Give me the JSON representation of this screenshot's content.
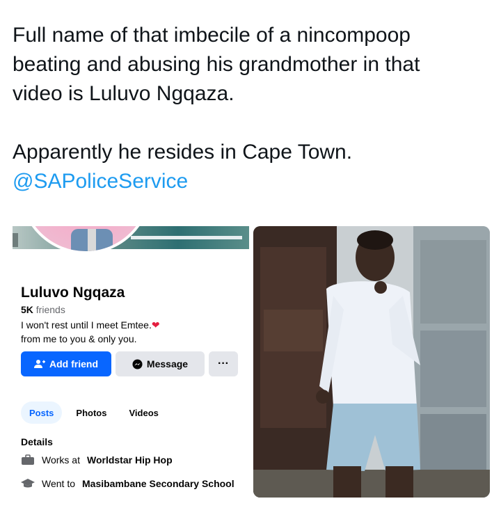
{
  "tweet": {
    "line1": "Full name of that imbecile of a nincompoop",
    "line2": "beating and abusing his grandmother in that",
    "line3": "video is Luluvo Ngqaza.",
    "line4": "Apparently he resides in Cape Town.",
    "mention": "@SAPoliceService"
  },
  "profile": {
    "name": "Luluvo Ngqaza",
    "friends_count": "5K",
    "friends_label": "friends",
    "bio_line1": "I won't rest until I meet Emtee.",
    "bio_heart": "❤",
    "bio_line2": "from me to you & only you.",
    "add_friend_label": "Add friend",
    "message_label": "Message",
    "more_label": "···",
    "tabs": [
      "Posts",
      "Photos",
      "Videos"
    ],
    "details_title": "Details",
    "work_prefix": "Works at",
    "work_place": "Worldstar Hip Hop",
    "school_prefix": "Went to",
    "school_place": "Masibambane Secondary School"
  },
  "colors": {
    "mention": "#1d9bf0",
    "fb_blue": "#0866ff",
    "button_gray": "#e4e6eb",
    "heart": "#e41e3f"
  }
}
